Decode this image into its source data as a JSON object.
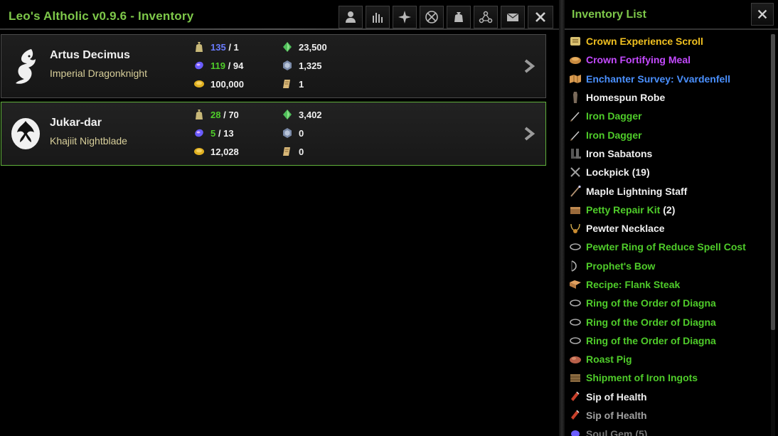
{
  "app": {
    "title": "Leo's Altholic v0.9.6 - Inventory"
  },
  "toolbar": {
    "buttons": [
      {
        "icon": "character-icon"
      },
      {
        "icon": "stats-icon"
      },
      {
        "icon": "skills-icon"
      },
      {
        "icon": "alliance-icon"
      },
      {
        "icon": "inventory-bag-icon"
      },
      {
        "icon": "crafting-icon"
      },
      {
        "icon": "mail-icon"
      },
      {
        "icon": "close-icon"
      }
    ]
  },
  "characters": [
    {
      "name": "Artus Decimus",
      "description": "Imperial Dragonknight",
      "bag_used": "135",
      "bag_sep": "/ 1",
      "soulgems_filled": "119",
      "soulgems_sep": "/ 94",
      "gold": "100,000",
      "crowns": "23,500",
      "alliance_points": "1,325",
      "vouchers": "1",
      "selected": false
    },
    {
      "name": "Jukar-dar",
      "description": "Khajiit Nightblade",
      "bag_used": "28",
      "bag_sep": "/ 70",
      "soulgems_filled": "5",
      "soulgems_sep": "/ 13",
      "gold": "12,028",
      "crowns": "3,402",
      "alliance_points": "0",
      "vouchers": "0",
      "selected": true
    }
  ],
  "side_panel": {
    "title": "Inventory List",
    "items": [
      {
        "name": "Crown Experience Scroll",
        "count": "",
        "color": "#f0c020",
        "icon": "scroll-icon"
      },
      {
        "name": "Crown Fortifying Meal",
        "count": "",
        "color": "#c44aff",
        "icon": "food-icon"
      },
      {
        "name": "Enchanter Survey: Vvardenfell",
        "count": "",
        "color": "#4a90ff",
        "icon": "survey-map-icon"
      },
      {
        "name": "Homespun Robe",
        "count": "",
        "color": "#f0f0f0",
        "icon": "robe-icon"
      },
      {
        "name": "Iron Dagger",
        "count": "",
        "color": "#4fcc2a",
        "icon": "dagger-icon"
      },
      {
        "name": "Iron Dagger",
        "count": "",
        "color": "#4fcc2a",
        "icon": "dagger-icon"
      },
      {
        "name": "Iron Sabatons",
        "count": "",
        "color": "#f0f0f0",
        "icon": "boots-icon"
      },
      {
        "name": "Lockpick",
        "count": "(19)",
        "color": "#f0f0f0",
        "icon": "lockpick-icon"
      },
      {
        "name": "Maple Lightning Staff",
        "count": "",
        "color": "#f0f0f0",
        "icon": "staff-icon"
      },
      {
        "name": "Petty Repair Kit",
        "count": "(2)",
        "color": "#4fcc2a",
        "icon": "repair-kit-icon"
      },
      {
        "name": "Pewter Necklace",
        "count": "",
        "color": "#f0f0f0",
        "icon": "necklace-icon"
      },
      {
        "name": "Pewter Ring of Reduce Spell Cost",
        "count": "",
        "color": "#4fcc2a",
        "icon": "ring-icon"
      },
      {
        "name": "Prophet's Bow",
        "count": "",
        "color": "#4fcc2a",
        "icon": "bow-icon"
      },
      {
        "name": "Recipe: Flank Steak",
        "count": "",
        "color": "#4fcc2a",
        "icon": "recipe-icon"
      },
      {
        "name": "Ring of the Order of Diagna",
        "count": "",
        "color": "#4fcc2a",
        "icon": "ring-icon"
      },
      {
        "name": "Ring of the Order of Diagna",
        "count": "",
        "color": "#4fcc2a",
        "icon": "ring-icon"
      },
      {
        "name": "Ring of the Order of Diagna",
        "count": "",
        "color": "#4fcc2a",
        "icon": "ring-icon"
      },
      {
        "name": "Roast Pig",
        "count": "",
        "color": "#4fcc2a",
        "icon": "roast-icon"
      },
      {
        "name": "Shipment of Iron Ingots",
        "count": "",
        "color": "#4fcc2a",
        "icon": "crate-icon"
      },
      {
        "name": "Sip of Health",
        "count": "",
        "color": "#f0f0f0",
        "icon": "potion-icon"
      },
      {
        "name": "Sip of Health",
        "count": "",
        "color": "#a0a0a0",
        "icon": "potion-icon"
      },
      {
        "name": "Soul Gem",
        "count": "(5)",
        "color": "#777777",
        "icon": "soul-gem-icon"
      }
    ]
  }
}
